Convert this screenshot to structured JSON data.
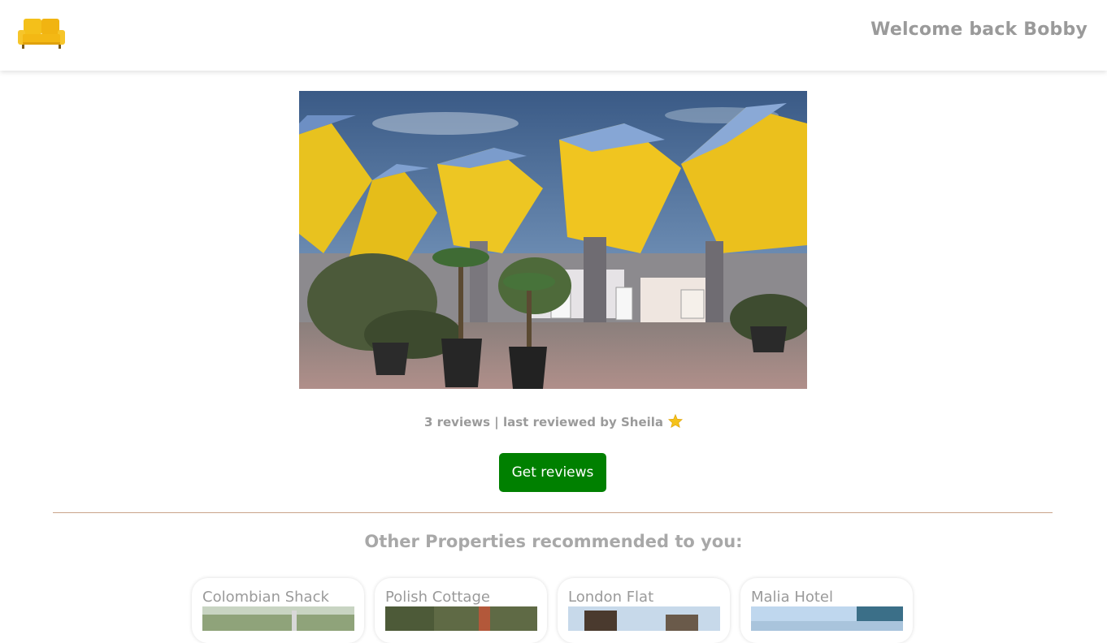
{
  "header": {
    "logo": "sofa-logo-icon",
    "welcome_text": "Welcome back Bobby"
  },
  "property": {
    "image": "cube-houses-photo",
    "review_summary": "3 reviews | last reviewed by Sheila",
    "star_icon": "star-icon",
    "get_reviews_label": "Get reviews"
  },
  "recommendations": {
    "title": "Other Properties recommended to you:",
    "cards": [
      {
        "title": "Colombian Shack"
      },
      {
        "title": "Polish Cottage"
      },
      {
        "title": "London Flat"
      },
      {
        "title": "Malia Hotel"
      }
    ]
  },
  "colors": {
    "button_green": "#008000",
    "text_grey": "#9a9a9a",
    "divider": "#c9a48a",
    "logo_yellow": "#f5c21b"
  }
}
